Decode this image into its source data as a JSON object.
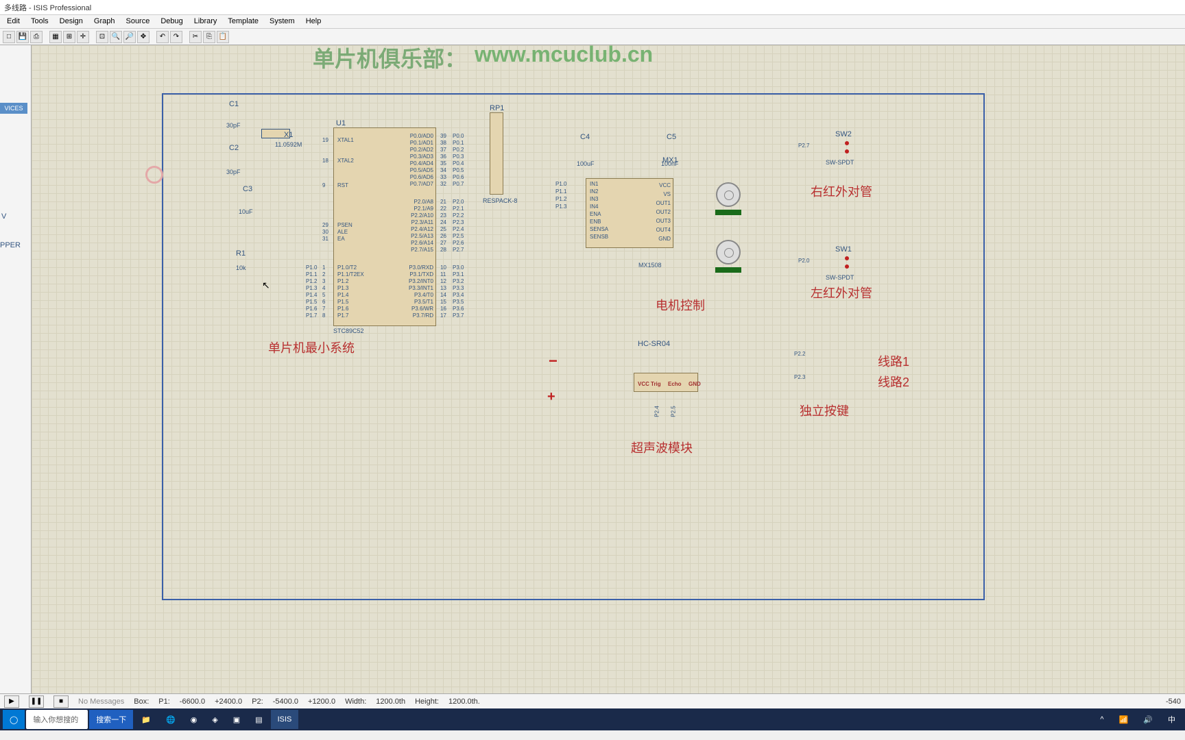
{
  "title": "多线路 - ISIS Professional",
  "menus": [
    "Edit",
    "Tools",
    "Design",
    "Graph",
    "Source",
    "Debug",
    "Library",
    "Template",
    "System",
    "Help"
  ],
  "watermark": {
    "text1": "单片机俱乐部：",
    "text2": "www.mcuclub.cn"
  },
  "sidebar": {
    "devices": "VICES",
    "pepper": "PPER",
    "v": "V"
  },
  "sections": {
    "mcu": "单片机最小系统",
    "motor": "电机控制",
    "ultrasonic": "超声波模块",
    "ir_right": "右红外对管",
    "ir_left": "左红外对管",
    "keys": "独立按键",
    "route1": "线路1",
    "route2": "线路2"
  },
  "components": {
    "C1": {
      "ref": "C1",
      "val": "30pF"
    },
    "C2": {
      "ref": "C2",
      "val": "30pF"
    },
    "C3": {
      "ref": "C3",
      "val": "10uF"
    },
    "C4": {
      "ref": "C4",
      "val": "100uF"
    },
    "C5": {
      "ref": "C5",
      "val": "100nF"
    },
    "X1": {
      "ref": "X1",
      "val": "11.0592M"
    },
    "R1": {
      "ref": "R1",
      "val": "10k"
    },
    "U1": {
      "ref": "U1",
      "val": "STC89C52"
    },
    "RP1": {
      "ref": "RP1",
      "val": "RESPACK-8"
    },
    "MX1": {
      "ref": "MX1",
      "val": "MX1508"
    },
    "HC": {
      "ref": "HC-SR04",
      "trig": "Trig",
      "echo": "Echo",
      "vcc": "VCC",
      "gnd": "GND"
    },
    "SW1": {
      "ref": "SW1",
      "val": "SW-SPDT"
    },
    "SW2": {
      "ref": "SW2",
      "val": "SW-SPDT"
    }
  },
  "mcu_pins_left": [
    "XTAL1",
    "XTAL2",
    "RST",
    "PSEN",
    "ALE",
    "EA",
    "P1.0/T2",
    "P1.1/T2EX",
    "P1.2",
    "P1.3",
    "P1.4",
    "P1.5",
    "P1.6",
    "P1.7"
  ],
  "mcu_pins_right": [
    "P0.0/AD0",
    "P0.1/AD1",
    "P0.2/AD2",
    "P0.3/AD3",
    "P0.4/AD4",
    "P0.5/AD5",
    "P0.6/AD6",
    "P0.7/AD7",
    "P2.0/A8",
    "P2.1/A9",
    "P2.2/A10",
    "P2.3/A11",
    "P2.4/A12",
    "P2.5/A13",
    "P2.6/A14",
    "P2.7/A15",
    "P3.0/RXD",
    "P3.1/TXD",
    "P3.2/INT0",
    "P3.3/INT1",
    "P3.4/T0",
    "P3.5/T1",
    "P3.6/WR",
    "P3.7/RD"
  ],
  "mcu_nets_right": [
    "P0.0",
    "P0.1",
    "P0.2",
    "P0.3",
    "P0.4",
    "P0.5",
    "P0.6",
    "P0.7",
    "P2.0",
    "P2.1",
    "P2.2",
    "P2.3",
    "P2.4",
    "P2.5",
    "P2.6",
    "P2.7",
    "P3.0",
    "P3.1",
    "P3.2",
    "P3.3",
    "P3.4",
    "P3.5",
    "P3.6",
    "P3.7"
  ],
  "mcu_pin_nums_left": [
    "19",
    "18",
    "9",
    "29",
    "30",
    "31",
    "1",
    "2",
    "3",
    "4",
    "5",
    "6",
    "7",
    "8"
  ],
  "mcu_pin_nums_right": [
    "39",
    "38",
    "37",
    "36",
    "35",
    "34",
    "33",
    "32",
    "21",
    "22",
    "23",
    "24",
    "25",
    "26",
    "27",
    "28",
    "10",
    "11",
    "12",
    "13",
    "14",
    "15",
    "16",
    "17"
  ],
  "p1_labels": [
    "P1.0",
    "P1.1",
    "P1.2",
    "P1.3",
    "P1.4",
    "P1.5",
    "P1.6",
    "P1.7"
  ],
  "mx_left": [
    "IN1",
    "IN2",
    "IN3",
    "IN4",
    "ENA",
    "ENB",
    "SENSA",
    "SENSB"
  ],
  "mx_left_nets": [
    "P1.0",
    "P1.1",
    "P1.2",
    "P1.3"
  ],
  "mx_right": [
    "VCC",
    "VS",
    "OUT1",
    "OUT2",
    "OUT3",
    "OUT4",
    "GND"
  ],
  "sw_nets": {
    "sw2": "P2.7",
    "sw1": "P2.0",
    "key1": "P2.2",
    "key2": "P2.3"
  },
  "hc_nets": [
    "P2.4",
    "P2.5"
  ],
  "status": {
    "nomsg": "No Messages",
    "box": "Box:",
    "p1": "P1:",
    "p1x": "-6600.0",
    "p1y": "+2400.0",
    "p2": "P2:",
    "p2x": "-5400.0",
    "p2y": "+1200.0",
    "w": "Width:",
    "wv": "1200.0th",
    "h": "Height:",
    "hv": "1200.0th.",
    "right": "-540"
  },
  "taskbar": {
    "search_ph": "输入你想搜的",
    "btn": "搜索一下",
    "ime": "中"
  }
}
